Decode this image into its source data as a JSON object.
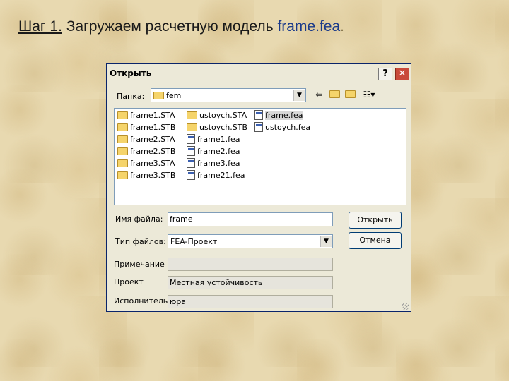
{
  "slide": {
    "title_step": "Шаг 1.",
    "title_text": "Загружаем расчетную модель",
    "title_file": "frame.fea",
    "title_dot": "."
  },
  "dialog": {
    "title": "Открыть",
    "help_label": "?",
    "close_label": "✕",
    "folder_label": "Папка:",
    "folder_value": "fem",
    "toolbar_icons": [
      "back-icon",
      "up-folder-icon",
      "new-folder-icon",
      "view-menu-icon"
    ],
    "files": [
      {
        "name": "frame1.STA",
        "icon": "folder-icon"
      },
      {
        "name": "frame1.STB",
        "icon": "folder-icon"
      },
      {
        "name": "frame2.STA",
        "icon": "folder-icon"
      },
      {
        "name": "frame2.STB",
        "icon": "folder-icon"
      },
      {
        "name": "frame3.STA",
        "icon": "folder-icon"
      },
      {
        "name": "frame3.STB",
        "icon": "folder-icon"
      },
      {
        "name": "ustoych.STA",
        "icon": "folder-icon"
      },
      {
        "name": "ustoych.STB",
        "icon": "folder-icon"
      },
      {
        "name": "frame1.fea",
        "icon": "fea-file-icon"
      },
      {
        "name": "frame2.fea",
        "icon": "fea-file-icon"
      },
      {
        "name": "frame3.fea",
        "icon": "fea-file-icon"
      },
      {
        "name": "frame21.fea",
        "icon": "fea-file-icon"
      },
      {
        "name": "frame.fea",
        "icon": "fea-file-icon",
        "selected": true
      },
      {
        "name": "ustoych.fea",
        "icon": "fea-file-icon"
      }
    ],
    "filename_label": "Имя файла:",
    "filename_value": "frame",
    "filetype_label": "Тип файлов:",
    "filetype_value": "FEA-Проект",
    "open_button": "Открыть",
    "cancel_button": "Отмена",
    "note_label": "Примечание",
    "note_value": "",
    "project_label": "Проект",
    "project_value": "Местная устойчивость",
    "author_label": "Исполнитель",
    "author_value": "юра"
  }
}
